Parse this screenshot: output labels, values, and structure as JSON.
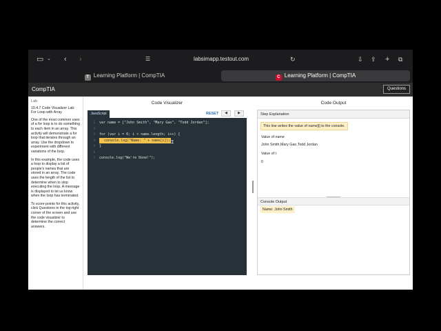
{
  "browser": {
    "url": "labsimapp.testout.com",
    "tabs": [
      {
        "label": "Learning Platform | CompTIA",
        "favicon": "T",
        "active": false
      },
      {
        "label": "Learning Platform | CompTIA",
        "favicon": "C",
        "active": true
      }
    ]
  },
  "app": {
    "brand": "CompTIA",
    "questions_label": "Questions"
  },
  "lab": {
    "section_label": "Lab",
    "title": "10.4.7 Code Visualizer Lab: For Loop with Array",
    "paragraphs": [
      "One of the most common uses of a for loop is to do something to each item in an array. This activity will demonstrate a for loop that iterates through an array. Use the dropdown to experiment with different variations of the loop.",
      "In this example, the code uses a loop to display a list of people's names that are stored in an array. The code uses the length of the list to determine when to stop executing the loop. A message is displayed to let us know when the loop has terminated.",
      "To score points for this activity, click Questions in the top-right corner of the screen and use the code visualizer to determine the correct answers."
    ]
  },
  "visualizer": {
    "title": "Code Visualizer",
    "language_tab": "JavaScript",
    "reset_label": "RESET",
    "prev_label": "◀",
    "next_label": "▶",
    "lines": [
      {
        "n": "1",
        "text": "var name = [\"John Smith\", \"Mary Gao\", \"Todd Jordan\"];"
      },
      {
        "n": "2",
        "text": ""
      },
      {
        "n": "3",
        "text": "for (var i = 0; i < name.length; i++) {"
      },
      {
        "n": "4",
        "text": "  console.log(\"Name: \" + name[i]);",
        "highlight": true
      },
      {
        "n": "5",
        "text": "}"
      },
      {
        "n": "6",
        "text": ""
      },
      {
        "n": "7",
        "text": "console.log(\"We're Done!\");"
      }
    ]
  },
  "output": {
    "title": "Code Output",
    "step_header": "Step Explanation",
    "explanation": "This line writes the value of name[i] to the console.",
    "var1_label": "Value of name",
    "var1_value": "John Smith,Mary Gao,Todd Jordan",
    "var2_label": "Value of i:",
    "var2_value": "0",
    "console_header": "Console Output",
    "console_line": "Name: John Smith"
  },
  "colors": {
    "editor_bg": "#263238",
    "highlight": "#f2c14e",
    "accent_link": "#2a6fb0"
  }
}
